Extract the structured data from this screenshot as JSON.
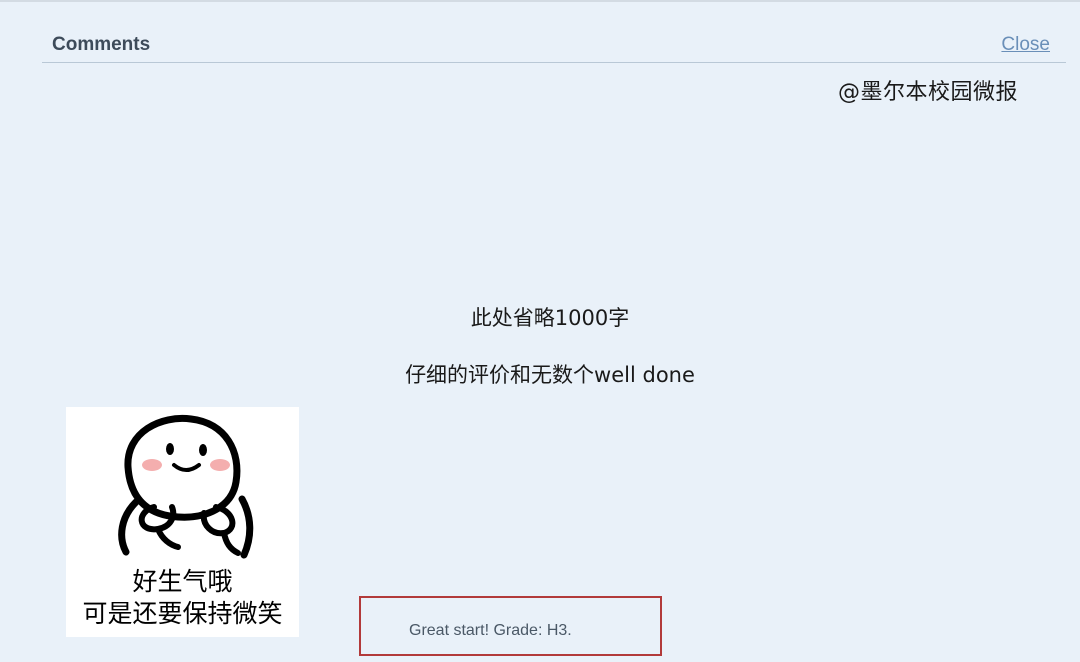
{
  "header": {
    "title": "Comments",
    "close_label": "Close"
  },
  "watermark": "@墨尔本校园微报",
  "body": {
    "line1": "此处省略1000字",
    "line2": "仔细的评价和无数个well done"
  },
  "meme": {
    "caption_line1": "好生气哦",
    "caption_line2": "可是还要保持微笑",
    "blush_color": "#f2a0a0"
  },
  "comment": {
    "text": "Great start! Grade: H3.",
    "highlight_color": "#b23a3a"
  },
  "colors": {
    "panel_bg": "#e9f1f9",
    "link": "#6a8fb8",
    "title": "#3d4b5a"
  }
}
